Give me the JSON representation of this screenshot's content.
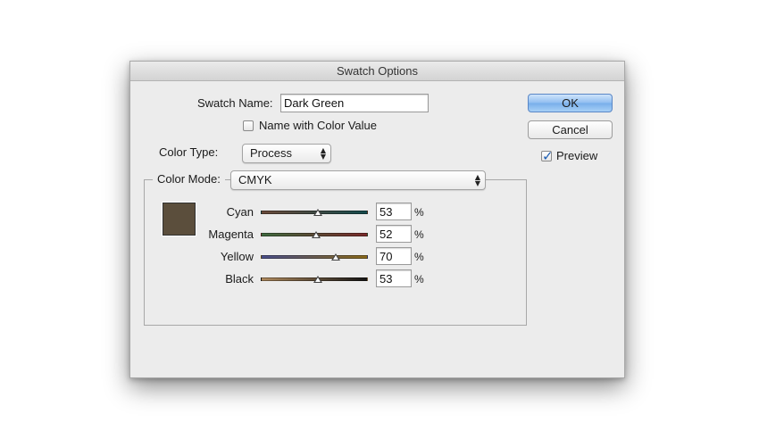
{
  "window": {
    "title": "Swatch Options"
  },
  "swatch_name": {
    "label": "Swatch Name:",
    "value": "Dark Green"
  },
  "name_with_color_value": {
    "label": "Name with Color Value",
    "checked": false
  },
  "color_type": {
    "label": "Color Type:",
    "selected": "Process"
  },
  "color_mode": {
    "label": "Color Mode:",
    "selected": "CMYK"
  },
  "swatch_color": "#5b4e3c",
  "sliders": [
    {
      "label": "Cyan",
      "value": "53",
      "unit": "%",
      "track_colors": [
        "#6b4a3a",
        "#144a4c"
      ]
    },
    {
      "label": "Magenta",
      "value": "52",
      "unit": "%",
      "track_colors": [
        "#3f6a3f",
        "#7a2a2a"
      ]
    },
    {
      "label": "Yellow",
      "value": "70",
      "unit": "%",
      "track_colors": [
        "#4a4f8a",
        "#8a6a1a"
      ]
    },
    {
      "label": "Black",
      "value": "53",
      "unit": "%",
      "track_colors": [
        "#b08a5e",
        "#151515"
      ]
    }
  ],
  "buttons": {
    "ok": "OK",
    "cancel": "Cancel"
  },
  "preview": {
    "label": "Preview",
    "checked": true
  }
}
